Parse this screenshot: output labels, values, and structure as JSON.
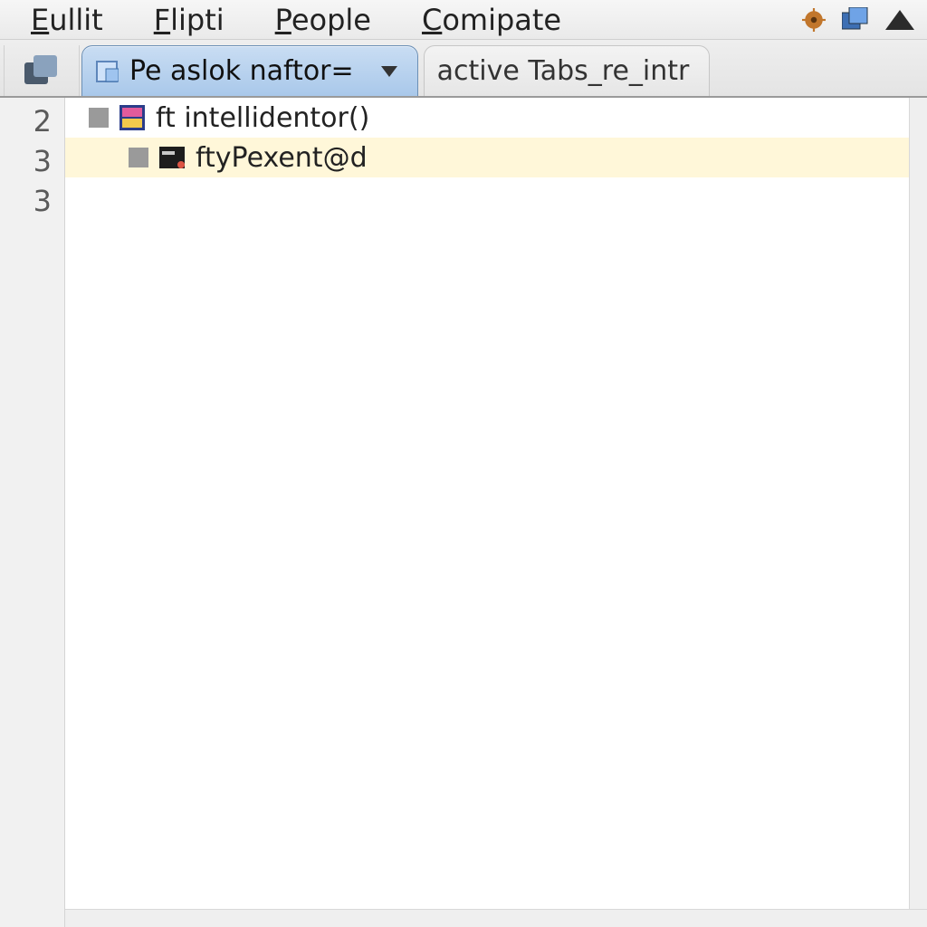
{
  "menu": {
    "items": [
      {
        "label": "Eullit",
        "accel_index": 0
      },
      {
        "label": "Flipti",
        "accel_index": 0
      },
      {
        "label": "People",
        "accel_index": 0
      },
      {
        "label": "Comipate",
        "accel_index": 0
      }
    ],
    "icons": {
      "gear": "gear-icon",
      "windows": "windows-icon",
      "up": "triangle-up-icon"
    }
  },
  "toolbar": {
    "copy_stack": "copy-stack"
  },
  "tabs": {
    "active": {
      "label": "Pe aslok naftor=",
      "has_dropdown": true
    },
    "inactive": {
      "label": "active Tabs_re_intr"
    }
  },
  "gutter_lines": [
    "2",
    "3",
    "3"
  ],
  "code": {
    "lines": [
      {
        "text": "ft intellidentor()",
        "icon": "file-icon-colorful",
        "indent": 0,
        "highlight": false
      },
      {
        "text": "ftyPexent@d",
        "icon": "file-icon-dark",
        "indent": 1,
        "highlight": true
      }
    ]
  }
}
